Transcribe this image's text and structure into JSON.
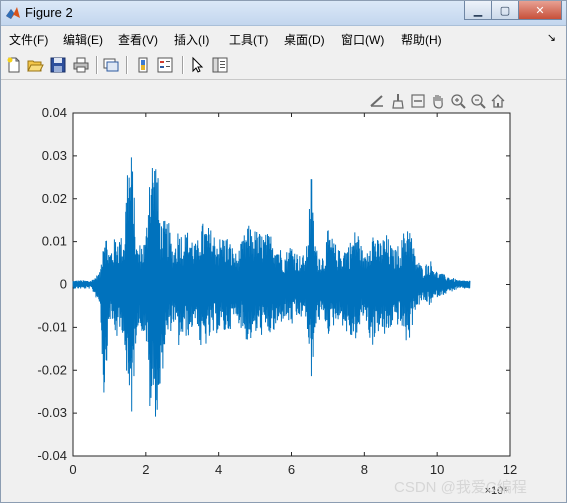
{
  "window": {
    "title": "Figure 2",
    "buttons": {
      "minimize": "▁",
      "maximize": "▢",
      "close": "✕"
    }
  },
  "menu": {
    "items": [
      "文件(F)",
      "编辑(E)",
      "查看(V)",
      "插入(I)",
      "工具(T)",
      "桌面(D)",
      "窗口(W)",
      "帮助(H)"
    ],
    "overflow_icon": "dock-arrow-icon"
  },
  "toolbar": {
    "buttons": [
      "new-figure-icon",
      "open-file-icon",
      "save-icon",
      "print-icon",
      "link-plot-icon",
      "colorbar-icon",
      "legend-icon",
      "edit-plot-arrow-icon",
      "property-editor-icon"
    ]
  },
  "axes_toolbar": {
    "buttons": [
      "export-icon",
      "brush-icon",
      "data-tips-icon",
      "pan-hand-icon",
      "zoom-in-icon",
      "zoom-out-icon",
      "home-icon"
    ]
  },
  "watermark": "CSDN @我爱C编程",
  "colors": {
    "line": "#0072BD",
    "background": "#f0f0f0",
    "axes_bg": "#ffffff"
  },
  "chart_data": {
    "type": "line",
    "title": "",
    "xlabel": "",
    "ylabel": "",
    "xlim": [
      0,
      12
    ],
    "ylim": [
      -0.04,
      0.04
    ],
    "xticks": [
      0,
      2,
      4,
      6,
      8,
      10,
      12
    ],
    "xtick_labels": [
      "0",
      "2",
      "4",
      "6",
      "8",
      "10",
      "12"
    ],
    "yticks": [
      -0.04,
      -0.03,
      -0.02,
      -0.01,
      0,
      0.01,
      0.02,
      0.03,
      0.04
    ],
    "ytick_labels": [
      "-0.04",
      "-0.03",
      "-0.02",
      "-0.01",
      "0",
      "0.01",
      "0.02",
      "0.03",
      "0.04"
    ],
    "x_exponent_label": "×10⁴",
    "grid": false,
    "legend": "none",
    "series": [
      {
        "color": "#0072BD",
        "envelope": {
          "x": [
            0,
            0.5,
            0.75,
            0.85,
            1.0,
            1.2,
            1.4,
            1.5,
            1.62,
            1.75,
            2.0,
            2.1,
            2.15,
            2.3,
            2.4,
            2.5,
            2.62,
            2.75,
            2.9,
            3.0,
            3.2,
            3.4,
            3.5,
            3.8,
            4.0,
            4.2,
            4.5,
            4.8,
            5.0,
            5.2,
            5.5,
            5.8,
            6.0,
            6.2,
            6.4,
            6.55,
            6.62,
            6.7,
            6.9,
            7.0,
            7.3,
            7.6,
            7.8,
            8.0,
            8.2,
            8.4,
            8.6,
            8.8,
            9.0,
            9.2,
            9.4,
            9.6,
            9.8,
            10.0,
            10.3,
            10.6,
            10.9
          ],
          "upper": [
            0.001,
            0.001,
            0.003,
            0.015,
            0.008,
            0.012,
            0.011,
            0.031,
            0.031,
            0.009,
            0.011,
            0.03,
            0.031,
            0.031,
            0.015,
            0.015,
            0.015,
            0.008,
            0.014,
            0.012,
            0.013,
            0.009,
            0.015,
            0.013,
            0.011,
            0.012,
            0.007,
            0.014,
            0.013,
            0.012,
            0.012,
            0.007,
            0.01,
            0.007,
            0.007,
            0.027,
            0.013,
            0.008,
            0.007,
            0.013,
            0.008,
            0.01,
            0.014,
            0.006,
            0.014,
            0.01,
            0.012,
            0.008,
            0.01,
            0.016,
            0.007,
            0.004,
            0.006,
            0.003,
            0.002,
            0.001,
            0.001
          ],
          "lower": [
            -0.001,
            -0.001,
            -0.005,
            -0.028,
            -0.008,
            -0.013,
            -0.011,
            -0.031,
            -0.031,
            -0.01,
            -0.012,
            -0.03,
            -0.031,
            -0.031,
            -0.028,
            -0.016,
            -0.013,
            -0.009,
            -0.015,
            -0.013,
            -0.012,
            -0.008,
            -0.016,
            -0.013,
            -0.011,
            -0.012,
            -0.008,
            -0.014,
            -0.012,
            -0.012,
            -0.012,
            -0.008,
            -0.01,
            -0.008,
            -0.008,
            -0.025,
            -0.013,
            -0.009,
            -0.008,
            -0.012,
            -0.008,
            -0.013,
            -0.013,
            -0.007,
            -0.015,
            -0.011,
            -0.013,
            -0.009,
            -0.01,
            -0.015,
            -0.006,
            -0.004,
            -0.005,
            -0.003,
            -0.002,
            -0.001,
            -0.001
          ]
        }
      }
    ]
  }
}
